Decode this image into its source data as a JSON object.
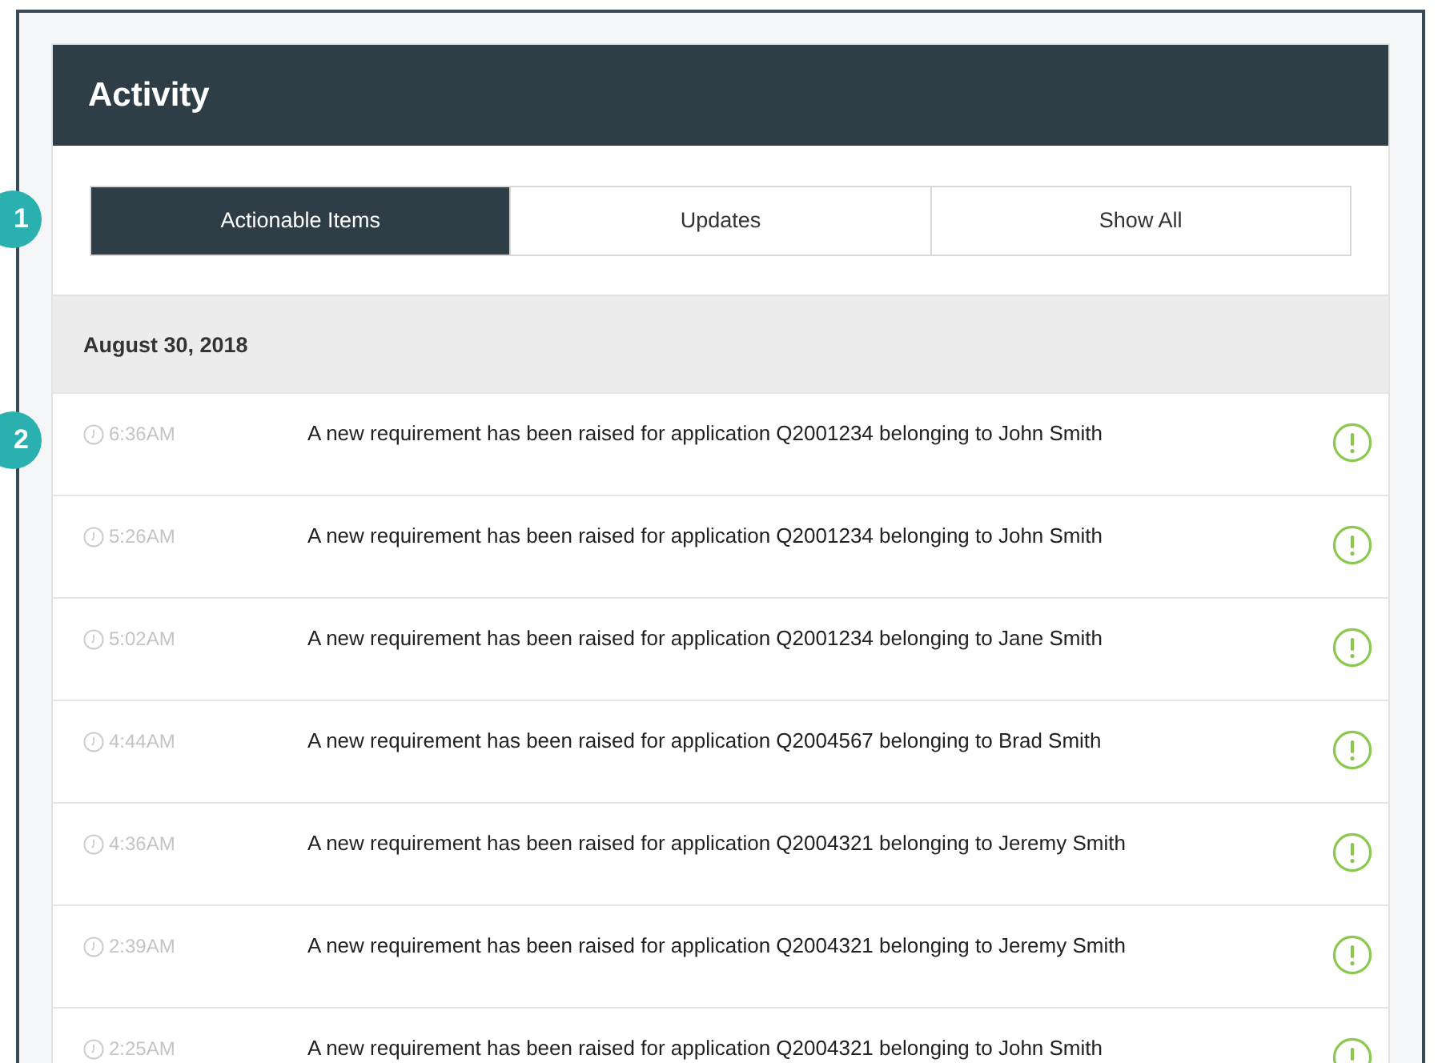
{
  "callouts": [
    "1",
    "2"
  ],
  "panel": {
    "title": "Activity"
  },
  "tabs": [
    {
      "label": "Actionable Items",
      "selected": true
    },
    {
      "label": "Updates",
      "selected": false
    },
    {
      "label": "Show All",
      "selected": false
    }
  ],
  "date_heading": "August 30, 2018",
  "items": [
    {
      "time": "6:36AM",
      "message": "A new requirement has been raised for application Q2001234 belonging to John Smith"
    },
    {
      "time": "5:26AM",
      "message": "A new requirement has been raised for application Q2001234 belonging to John Smith"
    },
    {
      "time": "5:02AM",
      "message": "A new requirement has been raised for application Q2001234 belonging to Jane Smith"
    },
    {
      "time": "4:44AM",
      "message": "A new requirement has been raised for application Q2004567 belonging to Brad Smith"
    },
    {
      "time": "4:36AM",
      "message": "A new requirement has been raised for application Q2004321 belonging to Jeremy Smith"
    },
    {
      "time": "2:39AM",
      "message": "A new requirement has been raised for application Q2004321 belonging to Jeremy Smith"
    },
    {
      "time": "2:25AM",
      "message": "A new requirement has been raised for application Q2004321 belonging to John Smith"
    }
  ]
}
